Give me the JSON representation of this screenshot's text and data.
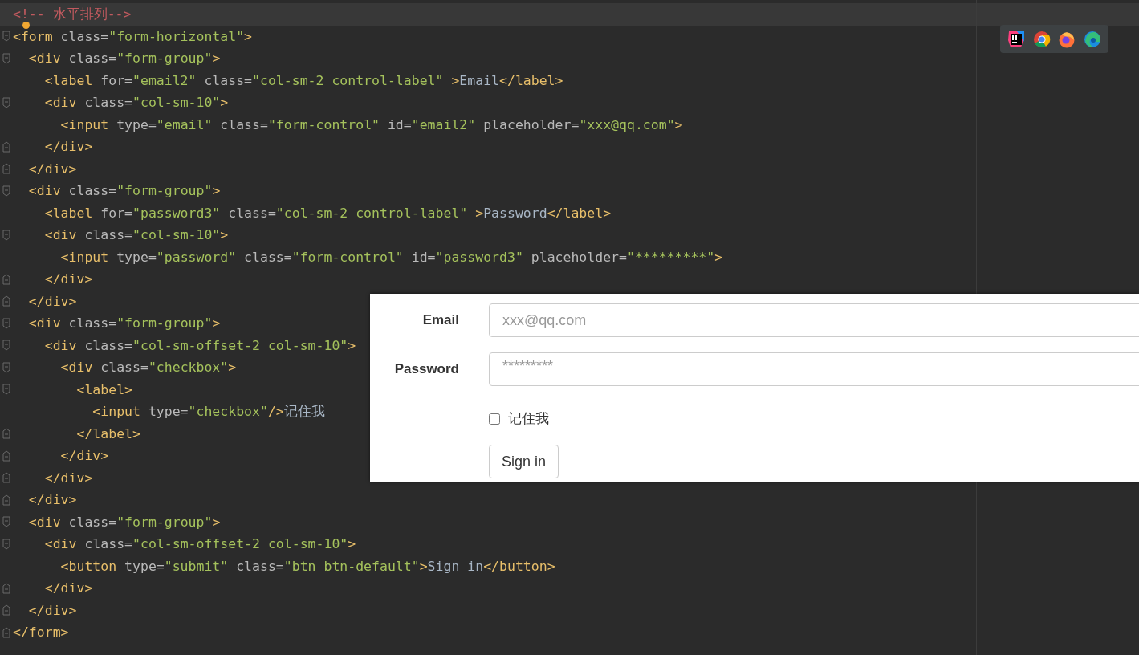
{
  "editor": {
    "lines": [
      {
        "current": true,
        "kind": "plain",
        "tokens": [
          {
            "kind": "comment",
            "text": "<!-- 水平排列-->"
          }
        ]
      },
      {
        "current": false,
        "kind": "opener",
        "tokens": [
          {
            "kind": "tag",
            "text": "<form"
          },
          {
            "kind": "attr",
            "text": " class="
          },
          {
            "kind": "value",
            "text": "\"form-horizontal\""
          },
          {
            "kind": "tag",
            "text": ">"
          }
        ]
      },
      {
        "current": false,
        "kind": "opener",
        "tokens": [
          {
            "kind": "tag",
            "text": "  <div"
          },
          {
            "kind": "attr",
            "text": " class="
          },
          {
            "kind": "value",
            "text": "\"form-group\""
          },
          {
            "kind": "tag",
            "text": ">"
          }
        ]
      },
      {
        "current": false,
        "kind": "plain",
        "tokens": [
          {
            "kind": "tag",
            "text": "    <label"
          },
          {
            "kind": "attr",
            "text": " for="
          },
          {
            "kind": "value",
            "text": "\"email2\""
          },
          {
            "kind": "attr",
            "text": " class="
          },
          {
            "kind": "value",
            "text": "\"col-sm-2 control-label\""
          },
          {
            "kind": "tag",
            "text": " >"
          },
          {
            "kind": "text",
            "text": "Email"
          },
          {
            "kind": "tag",
            "text": "</label>"
          }
        ]
      },
      {
        "current": false,
        "kind": "opener",
        "tokens": [
          {
            "kind": "tag",
            "text": "    <div"
          },
          {
            "kind": "attr",
            "text": " class="
          },
          {
            "kind": "value",
            "text": "\"col-sm-10\""
          },
          {
            "kind": "tag",
            "text": ">"
          }
        ]
      },
      {
        "current": false,
        "kind": "plain",
        "tokens": [
          {
            "kind": "tag",
            "text": "      <input"
          },
          {
            "kind": "attr",
            "text": " type="
          },
          {
            "kind": "value",
            "text": "\"email\""
          },
          {
            "kind": "attr",
            "text": " class="
          },
          {
            "kind": "value",
            "text": "\"form-control\""
          },
          {
            "kind": "attr",
            "text": " id="
          },
          {
            "kind": "value",
            "text": "\"email2\""
          },
          {
            "kind": "attr",
            "text": " placeholder="
          },
          {
            "kind": "value",
            "text": "\"xxx@qq.com\""
          },
          {
            "kind": "tag",
            "text": ">"
          }
        ]
      },
      {
        "current": false,
        "kind": "closer",
        "tokens": [
          {
            "kind": "tag",
            "text": "    </div>"
          }
        ]
      },
      {
        "current": false,
        "kind": "closer",
        "tokens": [
          {
            "kind": "tag",
            "text": "  </div>"
          }
        ]
      },
      {
        "current": false,
        "kind": "opener",
        "tokens": [
          {
            "kind": "tag",
            "text": "  <div"
          },
          {
            "kind": "attr",
            "text": " class="
          },
          {
            "kind": "value",
            "text": "\"form-group\""
          },
          {
            "kind": "tag",
            "text": ">"
          }
        ]
      },
      {
        "current": false,
        "kind": "plain",
        "tokens": [
          {
            "kind": "tag",
            "text": "    <label"
          },
          {
            "kind": "attr",
            "text": " for="
          },
          {
            "kind": "value",
            "text": "\"password3\""
          },
          {
            "kind": "attr",
            "text": " class="
          },
          {
            "kind": "value",
            "text": "\"col-sm-2 control-label\""
          },
          {
            "kind": "tag",
            "text": " >"
          },
          {
            "kind": "text",
            "text": "Password"
          },
          {
            "kind": "tag",
            "text": "</label>"
          }
        ]
      },
      {
        "current": false,
        "kind": "opener",
        "tokens": [
          {
            "kind": "tag",
            "text": "    <div"
          },
          {
            "kind": "attr",
            "text": " class="
          },
          {
            "kind": "value",
            "text": "\"col-sm-10\""
          },
          {
            "kind": "tag",
            "text": ">"
          }
        ]
      },
      {
        "current": false,
        "kind": "plain",
        "tokens": [
          {
            "kind": "tag",
            "text": "      <input"
          },
          {
            "kind": "attr",
            "text": " type="
          },
          {
            "kind": "value",
            "text": "\"password\""
          },
          {
            "kind": "attr",
            "text": " class="
          },
          {
            "kind": "value",
            "text": "\"form-control\""
          },
          {
            "kind": "attr",
            "text": " id="
          },
          {
            "kind": "value",
            "text": "\"password3\""
          },
          {
            "kind": "attr",
            "text": " placeholder="
          },
          {
            "kind": "value",
            "text": "\"*********\""
          },
          {
            "kind": "tag",
            "text": ">"
          }
        ]
      },
      {
        "current": false,
        "kind": "closer",
        "tokens": [
          {
            "kind": "tag",
            "text": "    </div>"
          }
        ]
      },
      {
        "current": false,
        "kind": "closer",
        "tokens": [
          {
            "kind": "tag",
            "text": "  </div>"
          }
        ]
      },
      {
        "current": false,
        "kind": "opener",
        "tokens": [
          {
            "kind": "tag",
            "text": "  <div"
          },
          {
            "kind": "attr",
            "text": " class="
          },
          {
            "kind": "value",
            "text": "\"form-group\""
          },
          {
            "kind": "tag",
            "text": ">"
          }
        ]
      },
      {
        "current": false,
        "kind": "opener",
        "tokens": [
          {
            "kind": "tag",
            "text": "    <div"
          },
          {
            "kind": "attr",
            "text": " class="
          },
          {
            "kind": "value",
            "text": "\"col-sm-offset-2 col-sm-10\""
          },
          {
            "kind": "tag",
            "text": ">"
          }
        ]
      },
      {
        "current": false,
        "kind": "opener",
        "tokens": [
          {
            "kind": "tag",
            "text": "      <div"
          },
          {
            "kind": "attr",
            "text": " class="
          },
          {
            "kind": "value",
            "text": "\"checkbox\""
          },
          {
            "kind": "tag",
            "text": ">"
          }
        ]
      },
      {
        "current": false,
        "kind": "opener",
        "tokens": [
          {
            "kind": "tag",
            "text": "        <label>"
          }
        ]
      },
      {
        "current": false,
        "kind": "plain",
        "tokens": [
          {
            "kind": "tag",
            "text": "          <input"
          },
          {
            "kind": "attr",
            "text": " type="
          },
          {
            "kind": "value",
            "text": "\"checkbox\""
          },
          {
            "kind": "tag",
            "text": "/>"
          },
          {
            "kind": "text",
            "text": "记住我"
          }
        ]
      },
      {
        "current": false,
        "kind": "closer",
        "tokens": [
          {
            "kind": "tag",
            "text": "        </label>"
          }
        ]
      },
      {
        "current": false,
        "kind": "closer",
        "tokens": [
          {
            "kind": "tag",
            "text": "      </div>"
          }
        ]
      },
      {
        "current": false,
        "kind": "closer",
        "tokens": [
          {
            "kind": "tag",
            "text": "    </div>"
          }
        ]
      },
      {
        "current": false,
        "kind": "closer",
        "tokens": [
          {
            "kind": "tag",
            "text": "  </div>"
          }
        ]
      },
      {
        "current": false,
        "kind": "opener",
        "tokens": [
          {
            "kind": "tag",
            "text": "  <div"
          },
          {
            "kind": "attr",
            "text": " class="
          },
          {
            "kind": "value",
            "text": "\"form-group\""
          },
          {
            "kind": "tag",
            "text": ">"
          }
        ]
      },
      {
        "current": false,
        "kind": "opener",
        "tokens": [
          {
            "kind": "tag",
            "text": "    <div"
          },
          {
            "kind": "attr",
            "text": " class="
          },
          {
            "kind": "value",
            "text": "\"col-sm-offset-2 col-sm-10\""
          },
          {
            "kind": "tag",
            "text": ">"
          }
        ]
      },
      {
        "current": false,
        "kind": "plain",
        "tokens": [
          {
            "kind": "tag",
            "text": "      <button"
          },
          {
            "kind": "attr",
            "text": " type="
          },
          {
            "kind": "value",
            "text": "\"submit\""
          },
          {
            "kind": "attr",
            "text": " class="
          },
          {
            "kind": "value",
            "text": "\"btn btn-default\""
          },
          {
            "kind": "tag",
            "text": ">"
          },
          {
            "kind": "text",
            "text": "Sign in"
          },
          {
            "kind": "tag",
            "text": "</button>"
          }
        ]
      },
      {
        "current": false,
        "kind": "closer",
        "tokens": [
          {
            "kind": "tag",
            "text": "    </div>"
          }
        ]
      },
      {
        "current": false,
        "kind": "closer",
        "tokens": [
          {
            "kind": "tag",
            "text": "  </div>"
          }
        ]
      },
      {
        "current": false,
        "kind": "closer",
        "tokens": [
          {
            "kind": "tag",
            "text": "</form>"
          }
        ]
      }
    ]
  },
  "preview": {
    "fields": [
      {
        "label": "Email",
        "placeholder": "xxx@qq.com"
      },
      {
        "label": "Password",
        "placeholder": "*********"
      }
    ],
    "remember": {
      "label": "记住我",
      "checked": false
    },
    "submit": "Sign in"
  }
}
